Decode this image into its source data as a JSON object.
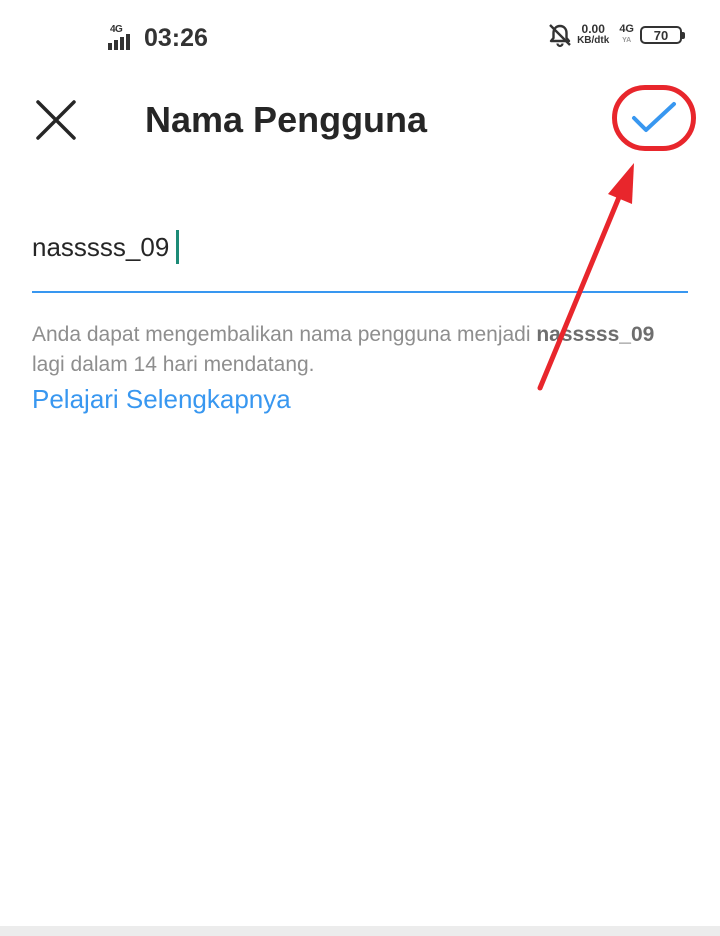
{
  "status_bar": {
    "network_left": "4G",
    "time": "03:26",
    "net_speed_value": "0.00",
    "net_speed_unit": "KB/dtk",
    "network_right": "4G",
    "network_right_sub": "YA",
    "battery": "70"
  },
  "header": {
    "title": "Nama Pengguna",
    "close_icon": "close-icon",
    "confirm_icon": "checkmark-icon"
  },
  "username": {
    "value": "nasssss_09"
  },
  "helper": {
    "text_before": "Anda dapat mengembalikan nama pengguna menjadi ",
    "username": "nasssss_09",
    "text_after": " lagi dalam 14 hari mendatang.",
    "link": "Pelajari Selengkapnya"
  },
  "colors": {
    "accent": "#3897f0",
    "annotation": "#e8262c",
    "caret": "#1c8b77"
  }
}
